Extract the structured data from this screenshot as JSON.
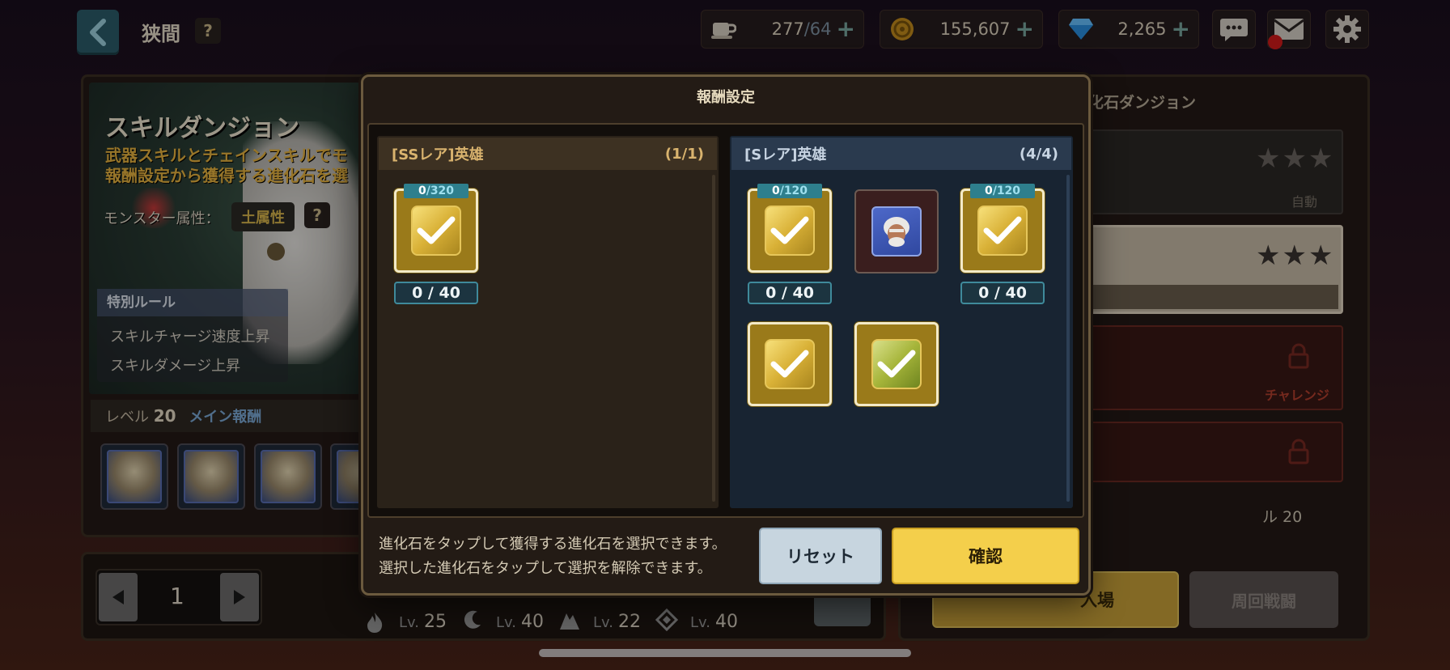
{
  "header": {
    "title": "狭間",
    "help_label": "?",
    "stamina_current": "277",
    "stamina_max": "/64",
    "gold": "155,607",
    "gems": "2,265"
  },
  "dungeon": {
    "title": "スキルダンジョン",
    "desc_line1": "武器スキルとチェインスキルでモ",
    "desc_line2": "報酬設定から獲得する進化石を選",
    "monster_attr_label": "モンスター属性：",
    "monster_attr_value": "土属性",
    "help_label": "?",
    "rules_head": "特別ルール",
    "rules": [
      "スキルチャージ速度上昇",
      "スキルダメージ上昇"
    ],
    "level_label": "レベル",
    "level_value": "20",
    "main_reward_label": "メイン報酬"
  },
  "page": {
    "current": "1"
  },
  "heroes": [
    {
      "lv_label": "Lv.",
      "lv": "25"
    },
    {
      "lv_label": "Lv.",
      "lv": "40"
    },
    {
      "lv_label": "Lv.",
      "lv": "22"
    },
    {
      "lv_label": "Lv.",
      "lv": "40"
    }
  ],
  "right_panel": {
    "title": "化石ダンジョン",
    "stars": "★★★",
    "auto_label": "自動",
    "challenge_label": "チャレンジ",
    "level_text": "ル 20",
    "enter_label": "入場",
    "auto_battle_label": "周回戦闘"
  },
  "modal": {
    "title": "報酬設定",
    "ss_section": {
      "title": "[SSレア]英雄",
      "count": "(1/1)",
      "items": [
        {
          "tag_n": "0",
          "tag_d": "/320",
          "progress": "0 / 40"
        }
      ]
    },
    "s_section": {
      "title": "[Sレア]英雄",
      "count": "(4/4)",
      "items": [
        {
          "tag_n": "0",
          "tag_d": "/120",
          "progress": "0 / 40"
        },
        {
          "tag_n": "0",
          "tag_d": "/120",
          "progress": "0 / 40"
        }
      ]
    },
    "hint_line1": "進化石をタップして獲得する進化石を選択できます。",
    "hint_line2": "選択した進化石をタップして選択を解除できます。",
    "reset_label": "リセット",
    "confirm_label": "確認"
  }
}
